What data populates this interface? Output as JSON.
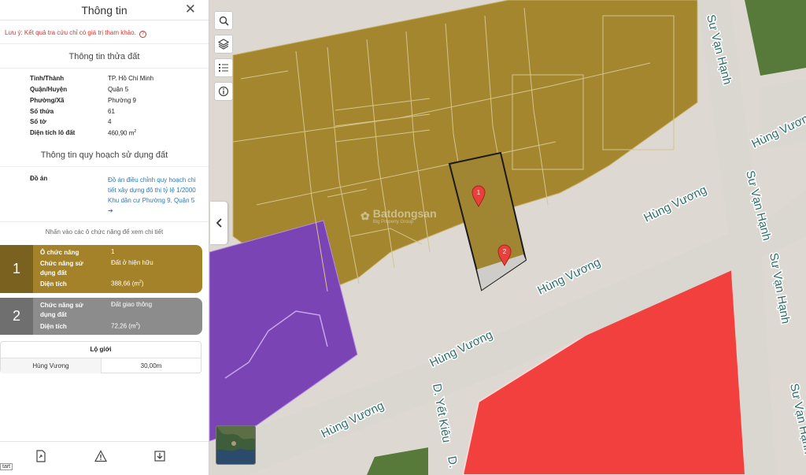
{
  "panel": {
    "title": "Thông tin",
    "notice": "Lưu ý: Kết quả tra cứu chỉ có giá trị tham khảo.",
    "parcel_section_title": "Thông tin thửa đất",
    "parcel": [
      {
        "label": "Tỉnh/Thành",
        "value": "TP. Hồ Chí Minh"
      },
      {
        "label": "Quận/Huyện",
        "value": "Quận 5"
      },
      {
        "label": "Phường/Xã",
        "value": "Phường 9"
      },
      {
        "label": "Số thửa",
        "value": "61"
      },
      {
        "label": "Số tờ",
        "value": "4"
      },
      {
        "label": "Diện tích lô đất",
        "value": "460,90 m",
        "unit_sup": "2"
      }
    ],
    "plan_section_title": "Thông tin quy hoạch sử dụng đất",
    "plan_label": "Đồ án",
    "plan_link": "Đồ án điều chỉnh quy hoạch chi tiết xây dựng đô thị tỷ lệ 1/2000 Khu dân cư Phường 9, Quận 5 ➔",
    "hint": "Nhấn vào các ô chức năng để xem chi tiết",
    "functions": [
      {
        "number": "1",
        "rows": [
          {
            "label": "Ô chức năng",
            "value": "1"
          },
          {
            "label": "Chức năng sử dụng đất",
            "value": "Đất ở hiện hữu"
          },
          {
            "label": "Diện tích",
            "value": "388,66 (m",
            "unit_sup": "2",
            "suffix": ")"
          }
        ],
        "color": "#a3822a"
      },
      {
        "number": "2",
        "rows": [
          {
            "label": "Chức năng sử dụng đất",
            "value": "Đất giao thông"
          },
          {
            "label": "Diện tích",
            "value": "72,26 (m",
            "unit_sup": "2",
            "suffix": ")"
          }
        ],
        "color": "#8c8c8c"
      }
    ],
    "road_table": {
      "header": "Lộ giới",
      "rows": [
        {
          "street": "Hùng Vương",
          "width": "30,00m"
        }
      ]
    },
    "start_tag": "tart"
  },
  "map": {
    "watermark": "Batdongsan",
    "watermark_sub": "Big Property Group",
    "markers": [
      "1",
      "2"
    ],
    "street_labels": {
      "hung_vuong": "Hùng Vương",
      "su_van_hanh": "Sư Vạn Hạnh",
      "d_yet_kieu": "D. Yết Kiêu",
      "d_short": "D."
    },
    "colors": {
      "residential": "#a3862e",
      "traffic": "#d2d0cc",
      "commercial": "#f2403e",
      "public": "#7b44b5",
      "green": "#577a3a"
    },
    "icons": [
      "search-icon",
      "layers-icon",
      "legend-list-icon",
      "info-icon"
    ]
  }
}
